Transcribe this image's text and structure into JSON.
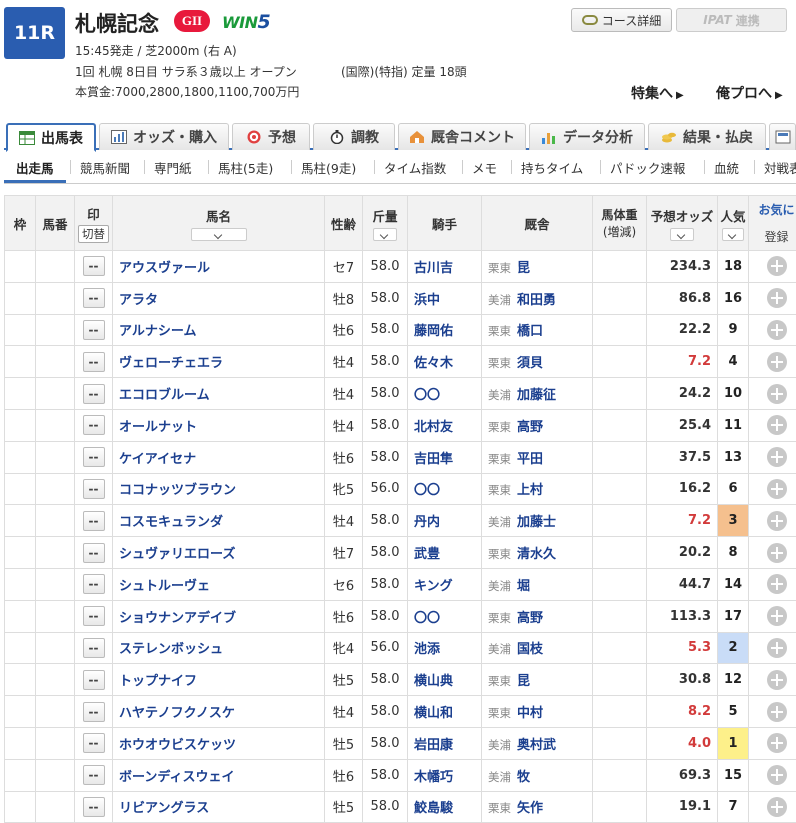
{
  "race": {
    "number": "11R",
    "title": "札幌記念",
    "grade": "GII",
    "win5_text": "WIN",
    "win5_num": "5",
    "start": "15:45発走 / 芝2000m (右 A)",
    "meta1": "1回 札幌 8日目 サラ系３歳以上 オープン",
    "meta2": "(国際)(特指) 定量 18頭",
    "prize": "本賞金:7000,2800,1800,1100,700万円"
  },
  "header_buttons": {
    "course": "コース詳細",
    "ipat": "連携",
    "ipat_logo": "IPAT"
  },
  "feature_links": {
    "special": "特集へ",
    "pro": "俺プロへ"
  },
  "main_tabs": [
    "出馬表",
    "オッズ・購入",
    "予想",
    "調教",
    "厩舎コメント",
    "データ分析",
    "結果・払戻"
  ],
  "sub_tabs": [
    "出走馬",
    "競馬新聞",
    "専門紙",
    "馬柱(5走)",
    "馬柱(9走)",
    "タイム指数",
    "メモ",
    "持ちタイム",
    "パドック速報",
    "血統",
    "対戦表"
  ],
  "columns": {
    "waku": "枠",
    "umaban": "馬番",
    "mark": "印",
    "mark_toggle": "切替",
    "name": "馬名",
    "sexage": "性齢",
    "weight": "斤量",
    "jockey": "騎手",
    "stable": "厩舎",
    "body_weight": "馬体重",
    "body_weight_sub": "(増減)",
    "odds": "予想オッズ",
    "pop": "人気",
    "fav": "お気に",
    "fav_reg": "登録"
  },
  "mark_default": "--",
  "horses": [
    {
      "name": "アウスヴァール",
      "sexage": "セ7",
      "weight": "58.0",
      "jockey": "古川吉",
      "region": "栗東",
      "trainer": "昆",
      "odds": "234.3",
      "pop": "18"
    },
    {
      "name": "アラタ",
      "sexage": "牡8",
      "weight": "58.0",
      "jockey": "浜中",
      "region": "美浦",
      "trainer": "和田勇",
      "odds": "86.8",
      "pop": "16"
    },
    {
      "name": "アルナシーム",
      "sexage": "牡6",
      "weight": "58.0",
      "jockey": "藤岡佑",
      "region": "栗東",
      "trainer": "橋口",
      "odds": "22.2",
      "pop": "9"
    },
    {
      "name": "ヴェローチェエラ",
      "sexage": "牡4",
      "weight": "58.0",
      "jockey": "佐々木",
      "region": "栗東",
      "trainer": "須貝",
      "odds": "7.2",
      "pop": "4",
      "low": true
    },
    {
      "name": "エコロブルーム",
      "sexage": "牡4",
      "weight": "58.0",
      "jockey": "〇〇",
      "region": "美浦",
      "trainer": "加藤征",
      "odds": "24.2",
      "pop": "10"
    },
    {
      "name": "オールナット",
      "sexage": "牡4",
      "weight": "58.0",
      "jockey": "北村友",
      "region": "栗東",
      "trainer": "高野",
      "odds": "25.4",
      "pop": "11"
    },
    {
      "name": "ケイアイセナ",
      "sexage": "牡6",
      "weight": "58.0",
      "jockey": "吉田隼",
      "region": "栗東",
      "trainer": "平田",
      "odds": "37.5",
      "pop": "13"
    },
    {
      "name": "ココナッツブラウン",
      "sexage": "牝5",
      "weight": "56.0",
      "jockey": "〇〇",
      "region": "栗東",
      "trainer": "上村",
      "odds": "16.2",
      "pop": "6"
    },
    {
      "name": "コスモキュランダ",
      "sexage": "牡4",
      "weight": "58.0",
      "jockey": "丹内",
      "region": "美浦",
      "trainer": "加藤士",
      "odds": "7.2",
      "pop": "3",
      "low": true,
      "rank": 3
    },
    {
      "name": "シュヴァリエローズ",
      "sexage": "牡7",
      "weight": "58.0",
      "jockey": "武豊",
      "region": "栗東",
      "trainer": "清水久",
      "odds": "20.2",
      "pop": "8"
    },
    {
      "name": "シュトルーヴェ",
      "sexage": "セ6",
      "weight": "58.0",
      "jockey": "キング",
      "region": "美浦",
      "trainer": "堀",
      "odds": "44.7",
      "pop": "14"
    },
    {
      "name": "ショウナンアデイブ",
      "sexage": "牡6",
      "weight": "58.0",
      "jockey": "〇〇",
      "region": "栗東",
      "trainer": "高野",
      "odds": "113.3",
      "pop": "17"
    },
    {
      "name": "ステレンボッシュ",
      "sexage": "牝4",
      "weight": "56.0",
      "jockey": "池添",
      "region": "美浦",
      "trainer": "国枝",
      "odds": "5.3",
      "pop": "2",
      "low": true,
      "rank": 2
    },
    {
      "name": "トップナイフ",
      "sexage": "牡5",
      "weight": "58.0",
      "jockey": "横山典",
      "region": "栗東",
      "trainer": "昆",
      "odds": "30.8",
      "pop": "12"
    },
    {
      "name": "ハヤテノフクノスケ",
      "sexage": "牡4",
      "weight": "58.0",
      "jockey": "横山和",
      "region": "栗東",
      "trainer": "中村",
      "odds": "8.2",
      "pop": "5",
      "low": true
    },
    {
      "name": "ホウオウビスケッツ",
      "sexage": "牡5",
      "weight": "58.0",
      "jockey": "岩田康",
      "region": "美浦",
      "trainer": "奥村武",
      "odds": "4.0",
      "pop": "1",
      "low": true,
      "rank": 1
    },
    {
      "name": "ボーンディスウェイ",
      "sexage": "牡6",
      "weight": "58.0",
      "jockey": "木幡巧",
      "region": "美浦",
      "trainer": "牧",
      "odds": "69.3",
      "pop": "15"
    },
    {
      "name": "リビアングラス",
      "sexage": "牡5",
      "weight": "58.0",
      "jockey": "鮫島駿",
      "region": "栗東",
      "trainer": "矢作",
      "odds": "19.1",
      "pop": "7"
    }
  ]
}
